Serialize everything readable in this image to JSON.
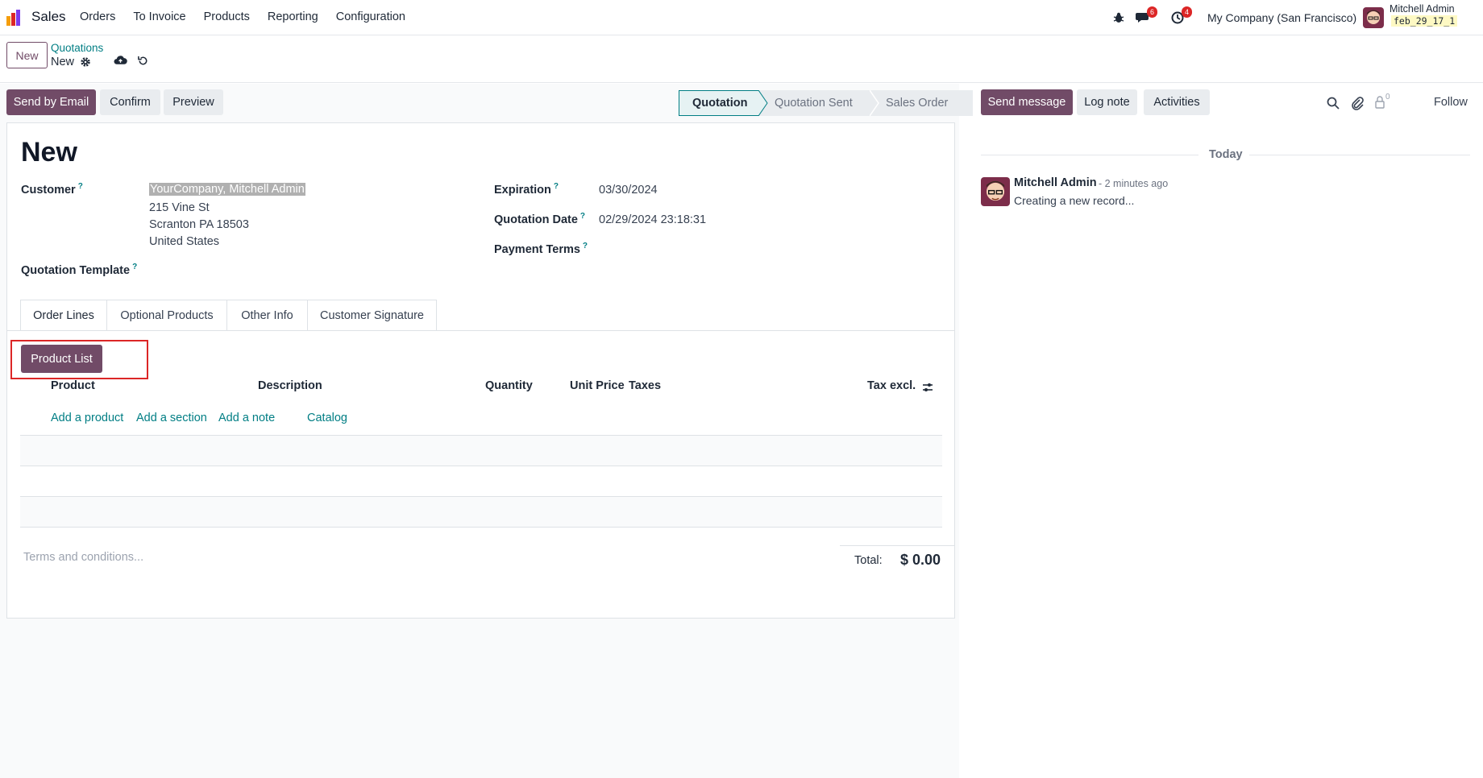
{
  "navbar": {
    "app_name": "Sales",
    "menu": [
      "Orders",
      "To Invoice",
      "Products",
      "Reporting",
      "Configuration"
    ],
    "messages_badge": "6",
    "activities_badge": "4",
    "company": "My Company (San Francisco)",
    "user_name": "Mitchell Admin",
    "db_name": "feb_29_17_1"
  },
  "control": {
    "new_label": "New",
    "breadcrumb_parent": "Quotations",
    "breadcrumb_current": "New"
  },
  "actions": {
    "send_email": "Send by Email",
    "confirm": "Confirm",
    "preview": "Preview"
  },
  "status": {
    "steps": [
      "Quotation",
      "Quotation Sent",
      "Sales Order"
    ],
    "active": "Quotation"
  },
  "form": {
    "title": "New",
    "customer_label": "Customer",
    "customer_name": "YourCompany, Mitchell Admin",
    "address": [
      "215 Vine St",
      "Scranton PA 18503",
      "United States"
    ],
    "template_label": "Quotation Template",
    "expiration_label": "Expiration",
    "expiration_value": "03/30/2024",
    "quotation_date_label": "Quotation Date",
    "quotation_date_value": "02/29/2024 23:18:31",
    "payment_terms_label": "Payment Terms",
    "help_mark": "?"
  },
  "tabs": [
    "Order Lines",
    "Optional Products",
    "Other Info",
    "Customer Signature"
  ],
  "order_lines": {
    "product_list_button": "Product List",
    "columns": [
      "Product",
      "Description",
      "Quantity",
      "Unit Price",
      "Taxes",
      "Tax excl."
    ],
    "links": [
      "Add a product",
      "Add a section",
      "Add a note",
      "Catalog"
    ],
    "terms_placeholder": "Terms and conditions...",
    "total_label": "Total:",
    "total_value": "$ 0.00"
  },
  "chatter": {
    "send_message": "Send message",
    "log_note": "Log note",
    "activities": "Activities",
    "followers_count": "0",
    "follow": "Follow",
    "today": "Today",
    "message_author": "Mitchell Admin",
    "message_time": "- 2 minutes ago",
    "message_body": "Creating a new record..."
  },
  "colors": {
    "primary": "#714b67",
    "link": "#017e84",
    "highlight": "#dc2626"
  }
}
